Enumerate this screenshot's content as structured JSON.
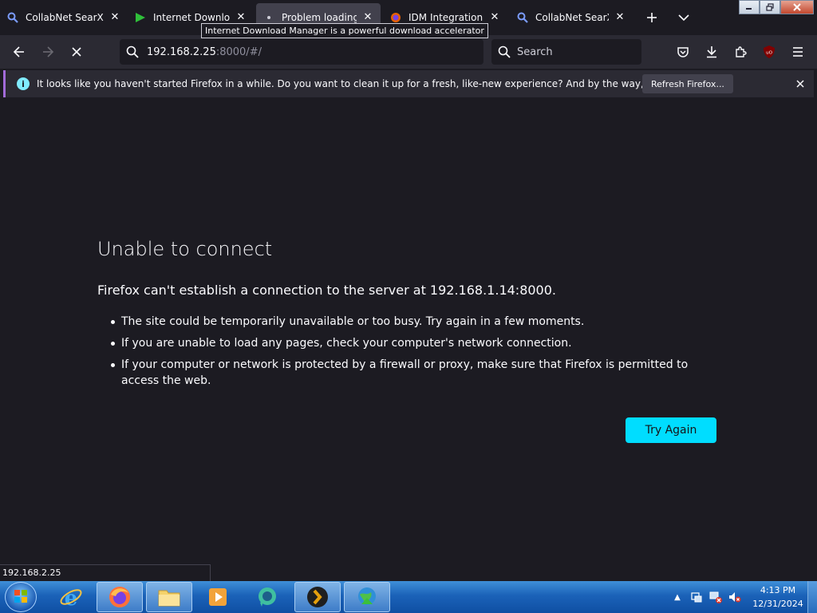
{
  "tabs": [
    {
      "title": "CollabNet SearXNG",
      "icon": "search-icon",
      "active": false
    },
    {
      "title": "Internet Download Manager",
      "icon": "idm-icon",
      "active": false
    },
    {
      "title": "Problem loading page",
      "icon": "dot-icon",
      "active": true
    },
    {
      "title": "IDM Integration Module",
      "icon": "firefox-addon-icon",
      "active": false
    },
    {
      "title": "CollabNet SearXNG",
      "icon": "search-icon",
      "active": false
    }
  ],
  "tooltip": "Internet Download Manager is a powerful download accelerator",
  "urlbar": {
    "host": "192.168.2.25",
    "rest": ":8000/#/"
  },
  "searchbar": {
    "placeholder": "Search"
  },
  "notification": {
    "message": "It looks like you haven't started Firefox in a while. Do you want to clean it up for a fresh, like-new experience? And by the way, welcome back!",
    "button": "Refresh Firefox..."
  },
  "error": {
    "title": "Unable to connect",
    "description": "Firefox can't establish a connection to the server at 192.168.1.14:8000.",
    "items": [
      "The site could be temporarily unavailable or too busy. Try again in a few moments.",
      "If you are unable to load any pages, check your computer's network connection.",
      "If your computer or network is protected by a firewall or proxy, make sure that Firefox is permitted to access the web."
    ],
    "button": "Try Again"
  },
  "status": "192.168.2.25",
  "clock": {
    "time": "4:13 PM",
    "date": "12/31/2024"
  },
  "colors": {
    "accent": "#00ddff",
    "background": "#1c1b22",
    "toolbar": "#2b2a33"
  }
}
